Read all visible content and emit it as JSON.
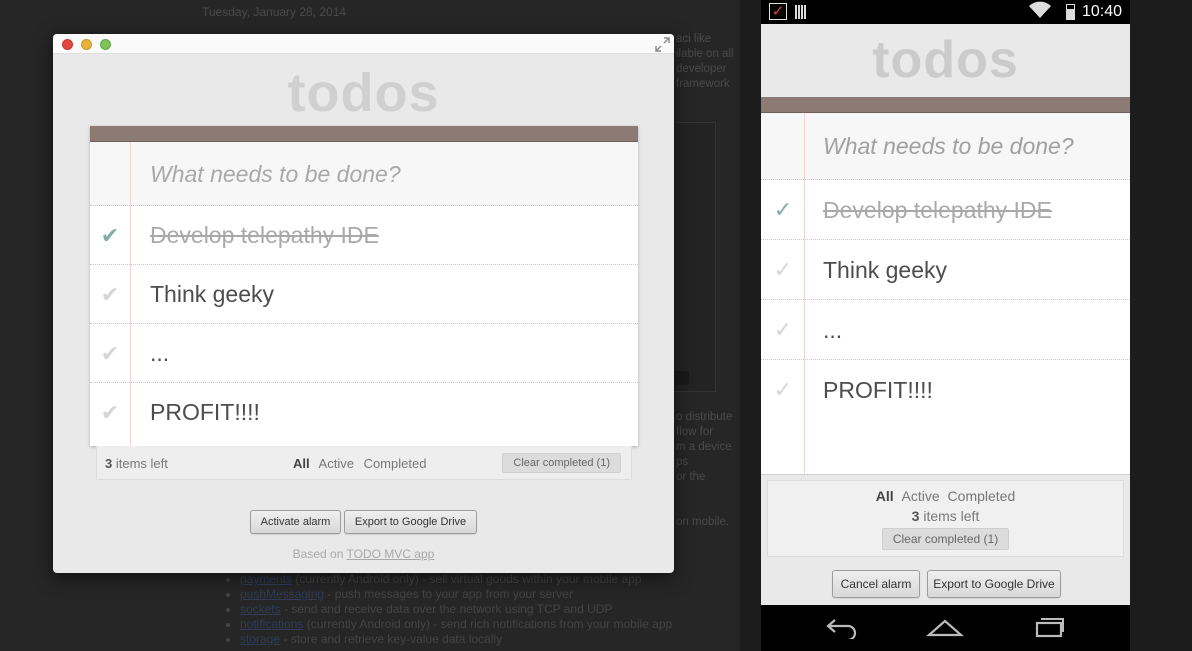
{
  "background_page": {
    "date": "Tuesday, January 28, 2014",
    "fragments": [
      "aci like",
      "ilable on all",
      "developer",
      "framework",
      "o distribute",
      "flow for",
      "m a device",
      "ps",
      "or the",
      "on mobile."
    ],
    "list": [
      {
        "link": "payments",
        "text": " (currently Android only) - sell virtual goods within your mobile app"
      },
      {
        "link": "pushMessaging",
        "text": " - push messages to your app from your server"
      },
      {
        "link": "sockets",
        "text": " - send and receive data over the network using TCP and UDP"
      },
      {
        "link": "notifications",
        "text": " (currently Android only) - send rich notifications from your mobile app"
      },
      {
        "link": "storage",
        "text": " - store and retrieve key-value data locally"
      }
    ]
  },
  "desktop": {
    "app_title": "todos",
    "new_todo_placeholder": "What needs to be done?",
    "todos": [
      {
        "text": "Develop telepathy IDE",
        "completed": true
      },
      {
        "text": "Think geeky",
        "completed": false
      },
      {
        "text": "...",
        "completed": false
      },
      {
        "text": "PROFIT!!!!",
        "completed": false
      }
    ],
    "footer": {
      "count": "3",
      "count_suffix": " items left",
      "filters": [
        "All",
        "Active",
        "Completed"
      ],
      "selected_filter": "All",
      "clear_label": "Clear completed (1)"
    },
    "buttons": {
      "alarm": "Activate alarm",
      "export": "Export to Google Drive"
    },
    "based_prefix": "Based on ",
    "based_link": "TODO MVC app"
  },
  "phone": {
    "status_time": "10:40",
    "app_title": "todos",
    "new_todo_placeholder": "What needs to be done?",
    "todos": [
      {
        "text": "Develop telepathy IDE",
        "completed": true
      },
      {
        "text": "Think geeky",
        "completed": false
      },
      {
        "text": "...",
        "completed": false
      },
      {
        "text": "PROFIT!!!!",
        "completed": false
      }
    ],
    "footer": {
      "filters": [
        "All",
        "Active",
        "Completed"
      ],
      "selected_filter": "All",
      "count": "3",
      "count_suffix": " items left",
      "clear_label": "Clear completed (1)"
    },
    "buttons": {
      "alarm": "Cancel alarm",
      "export": "Export to Google Drive"
    }
  },
  "colors": {
    "panel_header": "#8c7b74",
    "check_on": "#85ada7",
    "check_off": "#d6d6d6"
  },
  "icons": {
    "check": "✔",
    "wifi": "wifi-icon",
    "back": "back-icon",
    "home": "home-icon",
    "recents": "recents-icon"
  }
}
